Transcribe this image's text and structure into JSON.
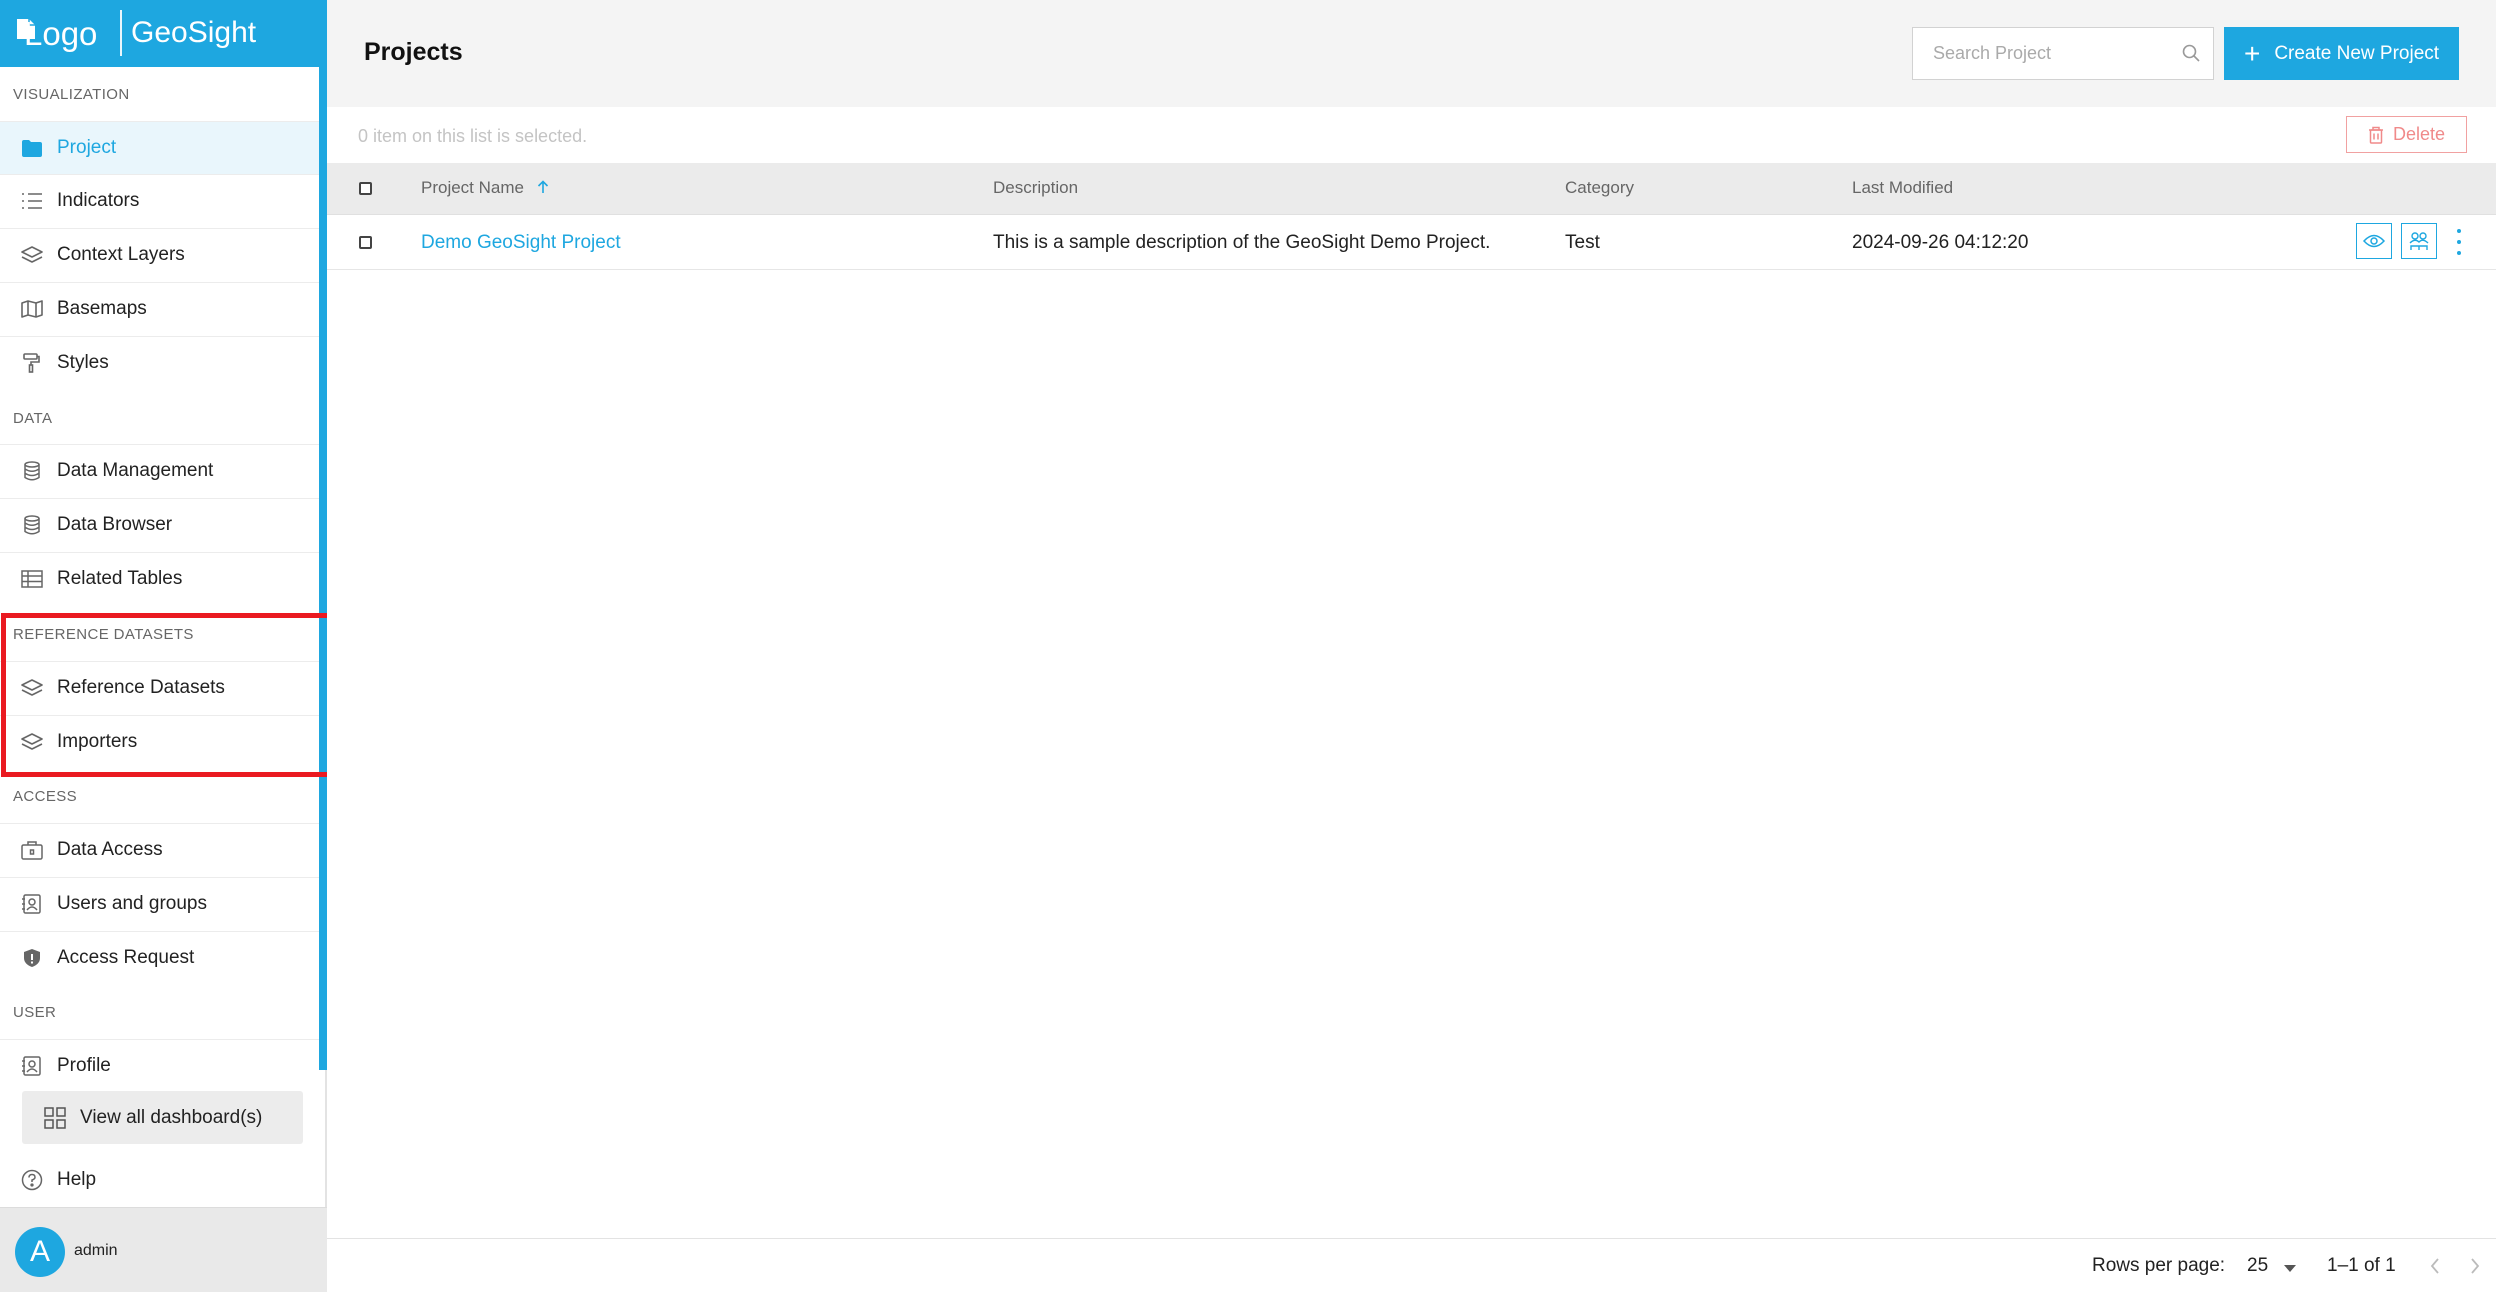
{
  "app": {
    "logo_text": "Logo",
    "name": "GeoSight",
    "accent_color": "#1ea7e0",
    "highlight_color": "#ea1a21"
  },
  "sidebar": {
    "sections": [
      {
        "title": "VISUALIZATION",
        "items": [
          {
            "label": "Project",
            "icon": "folder-icon",
            "active": true
          },
          {
            "label": "Indicators",
            "icon": "list-icon"
          },
          {
            "label": "Context Layers",
            "icon": "layers-icon"
          },
          {
            "label": "Basemaps",
            "icon": "map-icon"
          },
          {
            "label": "Styles",
            "icon": "paint-roller-icon"
          }
        ]
      },
      {
        "title": "DATA",
        "items": [
          {
            "label": "Data Management",
            "icon": "database-icon"
          },
          {
            "label": "Data Browser",
            "icon": "database-icon"
          },
          {
            "label": "Related Tables",
            "icon": "table-icon"
          }
        ]
      },
      {
        "title": "REFERENCE DATASETS",
        "items": [
          {
            "label": "Reference Datasets",
            "icon": "layers-icon"
          },
          {
            "label": "Importers",
            "icon": "layers-icon"
          }
        ]
      },
      {
        "title": "ACCESS",
        "items": [
          {
            "label": "Data Access",
            "icon": "briefcase-lock-icon"
          },
          {
            "label": "Users and groups",
            "icon": "contact-icon"
          },
          {
            "label": "Access Request",
            "icon": "shield-icon"
          }
        ]
      },
      {
        "title": "USER",
        "items": [
          {
            "label": "Profile",
            "icon": "contact-icon"
          }
        ]
      }
    ],
    "view_all_label": "View all dashboard(s)",
    "help_label": "Help",
    "user": {
      "avatar_letter": "A",
      "name": "admin"
    }
  },
  "main": {
    "title": "Projects",
    "search_placeholder": "Search Project",
    "create_label": "Create New Project",
    "selection_text": "0 item on this list is selected.",
    "delete_label": "Delete",
    "columns": [
      "Project Name",
      "Description",
      "Category",
      "Last Modified"
    ],
    "rows": [
      {
        "name": "Demo GeoSight Project",
        "description": "This is a sample description of the GeoSight Demo Project.",
        "category": "Test",
        "last_modified": "2024-09-26 04:12:20"
      }
    ],
    "footer": {
      "rows_per_page_label": "Rows per page:",
      "rows_per_page_value": "25",
      "range_text": "1–1 of 1"
    }
  }
}
